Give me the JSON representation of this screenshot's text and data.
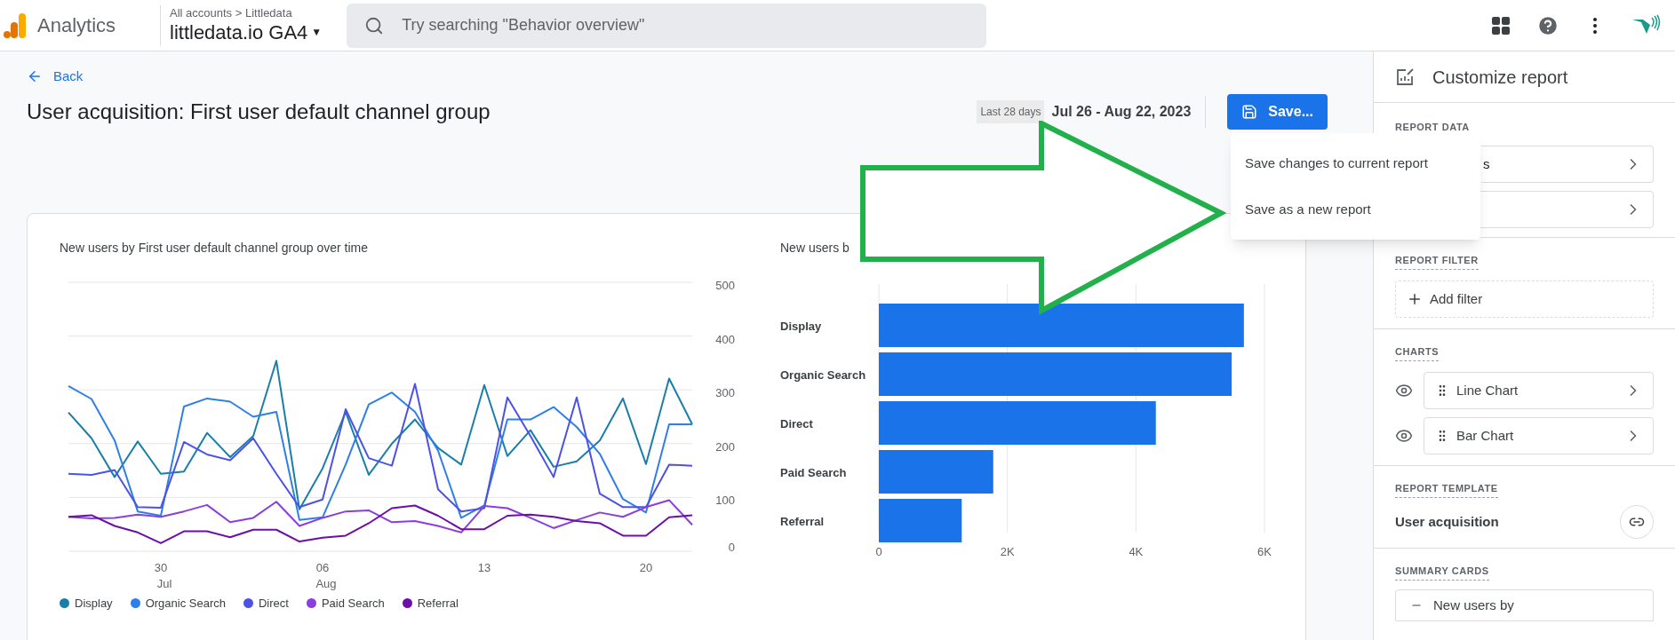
{
  "app": {
    "name": "Analytics"
  },
  "account": {
    "breadcrumb": "All accounts > Littledata",
    "property": "littledata.io GA4",
    "caret": "▼"
  },
  "search": {
    "placeholder": "Try searching \"Behavior overview\""
  },
  "back": "Back",
  "report_title": "User acquisition: First user default channel group",
  "date_range": {
    "preset": "Last 28 days",
    "range": "Jul 26 - Aug 22, 2023"
  },
  "save_button": "Save...",
  "save_menu": [
    "Save changes to current report",
    "Save as a new report"
  ],
  "line_chart": {
    "title": "New users by First user default channel group over time",
    "chart_data": {
      "type": "line",
      "categories": [
        null,
        null,
        null,
        null,
        "30",
        null,
        null,
        null,
        null,
        null,
        null,
        "06",
        null,
        null,
        null,
        null,
        null,
        null,
        "13",
        null,
        null,
        null,
        null,
        null,
        null,
        "20",
        null,
        null
      ],
      "ylim": [
        0,
        500
      ],
      "yticks": [
        0,
        100,
        200,
        300,
        400,
        500
      ],
      "grid": true,
      "annotations": [
        "Jul",
        "Aug"
      ],
      "series": [
        {
          "name": "Display",
          "color": "#1a7fa8",
          "values": [
            258,
            210,
            138,
            204,
            144,
            148,
            220,
            175,
            214,
            354,
            78,
            154,
            259,
            142,
            200,
            245,
            192,
            161,
            309,
            177,
            225,
            157,
            167,
            206,
            284,
            162,
            321,
            236
          ]
        },
        {
          "name": "Organic Search",
          "color": "#2e7fe8",
          "values": [
            307,
            283,
            206,
            74,
            66,
            269,
            284,
            278,
            250,
            259,
            58,
            63,
            161,
            273,
            295,
            259,
            187,
            62,
            85,
            245,
            245,
            268,
            231,
            181,
            97,
            72,
            236,
            236
          ]
        },
        {
          "name": "Direct",
          "color": "#4d52e6",
          "values": [
            144,
            142,
            151,
            82,
            81,
            203,
            180,
            169,
            210,
            144,
            82,
            96,
            264,
            173,
            159,
            311,
            115,
            74,
            80,
            286,
            214,
            138,
            286,
            107,
            82,
            82,
            161,
            159
          ]
        },
        {
          "name": "Paid Search",
          "color": "#8a3fdc",
          "values": [
            64,
            61,
            62,
            68,
            64,
            74,
            86,
            54,
            62,
            92,
            47,
            62,
            74,
            76,
            54,
            56,
            47,
            35,
            84,
            80,
            62,
            43,
            58,
            72,
            64,
            82,
            95,
            49
          ]
        },
        {
          "name": "Referral",
          "color": "#6c0fa6",
          "values": [
            64,
            67,
            47,
            35,
            15,
            37,
            37,
            26,
            40,
            40,
            18,
            25,
            29,
            52,
            80,
            85,
            66,
            41,
            41,
            66,
            68,
            64,
            56,
            52,
            29,
            29,
            63,
            67
          ]
        }
      ]
    }
  },
  "bar_chart": {
    "title": "New users b",
    "chart_data": {
      "type": "bar",
      "orientation": "horizontal",
      "categories": [
        "Display",
        "Organic Search",
        "Direct",
        "Paid Search",
        "Referral"
      ],
      "series": [
        {
          "color": "#1a73e8",
          "values": [
            5680,
            5490,
            4310,
            1780,
            1290
          ]
        }
      ],
      "xlim": [
        0,
        6000
      ],
      "xticks": [
        {
          "value": 0,
          "label": "0"
        },
        {
          "value": 2000,
          "label": "2K"
        },
        {
          "value": 4000,
          "label": "4K"
        },
        {
          "value": 6000,
          "label": "6K"
        }
      ]
    }
  },
  "customize_panel": {
    "title": "Customize report",
    "report_data": {
      "heading": "REPORT DATA",
      "items": [
        {
          "label": "s",
          "chevron": true
        },
        {
          "chevron": true
        }
      ]
    },
    "report_filter": {
      "heading": "REPORT FILTER",
      "add_label": "Add filter"
    },
    "charts": {
      "heading": "CHARTS",
      "items": [
        {
          "label": "Line Chart",
          "visible": true
        },
        {
          "label": "Bar Chart",
          "visible": true
        }
      ]
    },
    "report_template": {
      "heading": "REPORT TEMPLATE",
      "name": "User acquisition"
    },
    "summary_cards": {
      "heading": "SUMMARY CARDS",
      "cards": [
        "New users by"
      ]
    }
  }
}
